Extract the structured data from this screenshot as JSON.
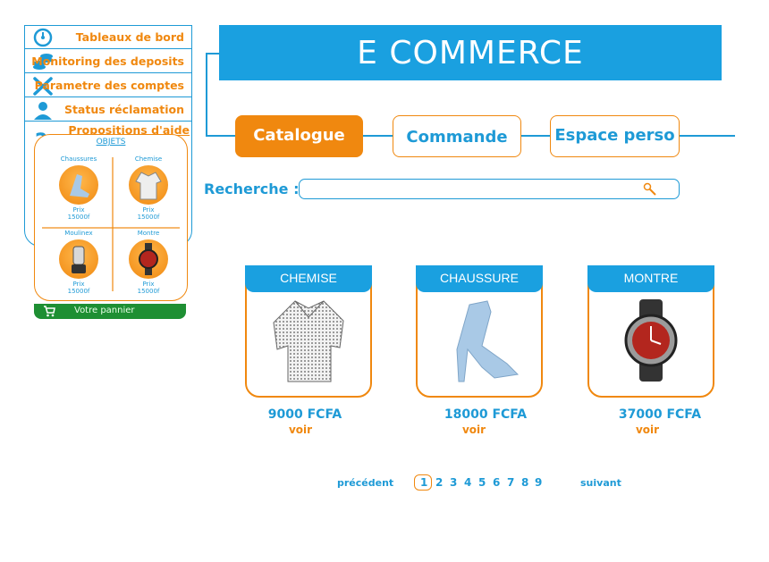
{
  "sidebar": {
    "items": [
      {
        "label": "Tableaux de bord",
        "icon": "dashboard-icon"
      },
      {
        "label": "Monitoring des deposits",
        "icon": "coins-icon"
      },
      {
        "label": "Parametre des comptes",
        "icon": "tools-icon"
      },
      {
        "label": "Status réclamation",
        "icon": "support-agent-icon"
      },
      {
        "label": "Propositions d'aide",
        "icon": "help-icon"
      }
    ]
  },
  "cart": {
    "title": "OBJETS",
    "items": [
      {
        "name": "Chaussures",
        "price_label": "Prix",
        "price": "15000f",
        "icon": "shoe-icon"
      },
      {
        "name": "Chemise",
        "price_label": "Prix",
        "price": "15000f",
        "icon": "shirt-icon"
      },
      {
        "name": "Moulinex",
        "price_label": "Prix",
        "price": "15000f",
        "icon": "blender-icon"
      },
      {
        "name": "Montre",
        "price_label": "Prix",
        "price": "15000f",
        "icon": "watch-icon"
      }
    ],
    "bar_label": "Votre pannier"
  },
  "header": {
    "title": "E COMMERCE"
  },
  "tabs": [
    {
      "label": "Catalogue",
      "active": true
    },
    {
      "label": "Commande",
      "active": false
    },
    {
      "label": "Espace perso",
      "active": false
    }
  ],
  "search": {
    "label": "Recherche :",
    "value": ""
  },
  "products": [
    {
      "name": "CHEMISE",
      "price": "9000 FCFA",
      "link": "voir",
      "icon": "shirt-icon"
    },
    {
      "name": "CHAUSSURE",
      "price": "18000 FCFA",
      "link": "voir",
      "icon": "shoe-icon"
    },
    {
      "name": "MONTRE",
      "price": "37000 FCFA",
      "link": "voir",
      "icon": "watch-icon"
    }
  ],
  "pagination": {
    "prev": "précédent",
    "next": "suivant",
    "pages": [
      "1",
      "2",
      "3",
      "4",
      "5",
      "6",
      "7",
      "8",
      "9"
    ],
    "current": "1"
  },
  "colors": {
    "blue": "#1aa0e0",
    "orange": "#f0880f",
    "green": "#1e8f33"
  }
}
